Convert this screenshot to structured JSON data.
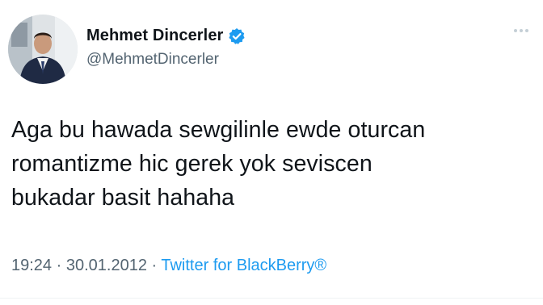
{
  "author": {
    "display_name": "Mehmet Dincerler",
    "handle": "@MehmetDincerler",
    "verified": true,
    "avatar_icon": "profile-photo"
  },
  "tweet": {
    "lines": [
      "Aga bu hawada sewgilinle ewde oturcan",
      "romantizme hic gerek yok seviscen",
      "bukadar basit hahaha"
    ]
  },
  "meta": {
    "time": "19:24",
    "separator": " · ",
    "date": "30.01.2012",
    "source": "Twitter for BlackBerry®"
  },
  "icons": {
    "verified": "verified-badge-icon",
    "more": "more-options-icon"
  },
  "colors": {
    "text": "#0f1419",
    "secondary": "#536471",
    "accent": "#1d9bf0"
  }
}
